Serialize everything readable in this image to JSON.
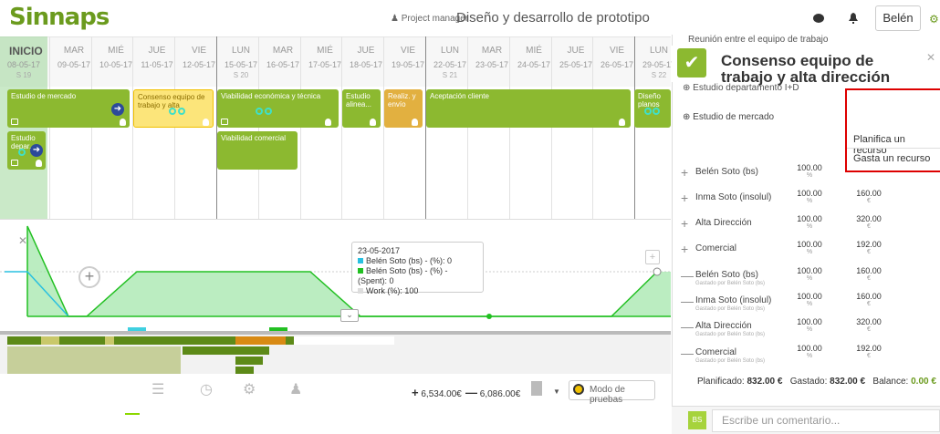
{
  "app": {
    "logo": "Sinnaps",
    "role_label": "Project manager",
    "project_title": "Diseño y desarrollo de prototipo",
    "user": "Belén"
  },
  "calendar": {
    "start_label": "INICIO",
    "days": [
      {
        "name": "MAR",
        "date": "08-05-17",
        "week": "S 19"
      },
      {
        "name": "MAR",
        "date": "09-05-17",
        "week": ""
      },
      {
        "name": "MIÉ",
        "date": "10-05-17",
        "week": ""
      },
      {
        "name": "JUE",
        "date": "11-05-17",
        "week": ""
      },
      {
        "name": "VIE",
        "date": "12-05-17",
        "week": ""
      },
      {
        "name": "LUN",
        "date": "15-05-17",
        "week": "S 20"
      },
      {
        "name": "MAR",
        "date": "16-05-17",
        "week": ""
      },
      {
        "name": "MIÉ",
        "date": "17-05-17",
        "week": ""
      },
      {
        "name": "JUE",
        "date": "18-05-17",
        "week": ""
      },
      {
        "name": "VIE",
        "date": "19-05-17",
        "week": ""
      },
      {
        "name": "LUN",
        "date": "22-05-17",
        "week": "S 21"
      },
      {
        "name": "MAR",
        "date": "23-05-17",
        "week": ""
      },
      {
        "name": "MIÉ",
        "date": "24-05-17",
        "week": ""
      },
      {
        "name": "JUE",
        "date": "25-05-17",
        "week": ""
      },
      {
        "name": "VIE",
        "date": "26-05-17",
        "week": ""
      },
      {
        "name": "LUN",
        "date": "29-05-17",
        "week": "S 22"
      }
    ]
  },
  "tasks": [
    {
      "label": "Estudio de mercado"
    },
    {
      "label": "Consenso equipo de trabajo y alta"
    },
    {
      "label": "Viabilidad económica y técnica"
    },
    {
      "label": "Estudio alinea..."
    },
    {
      "label": "Realiz. y envío"
    },
    {
      "label": "Aceptación cliente"
    },
    {
      "label": "Diseño planos"
    },
    {
      "label": "Estudio depar..."
    },
    {
      "label": "Viabilidad comercial"
    }
  ],
  "tooltip": {
    "date": "23-05-2017",
    "line1": "Belén Soto (bs) - (%): 0",
    "line2": "Belén Soto (bs) - (%) - (Spent): 0",
    "line3": "Work (%): 100"
  },
  "toolbar": {
    "plus_amount": "6,534.00€",
    "minus_amount": "6,086.00€",
    "test_mode": "Modo de pruebas"
  },
  "panel": {
    "top_line": "Reunión entre el equipo de trabajo",
    "title": "Consenso equipo de trabajo y alta dirección",
    "dep_line": "Estudio departamento I+D",
    "sub_item": "Estudio de mercado",
    "menu": {
      "plan": "Planifica un recurso",
      "spend": "Gasta un recurso"
    },
    "resources": [
      {
        "sym": "+",
        "name": "Belén Soto (bs)",
        "sub": "",
        "pct": "100.00",
        "pct_u": "%",
        "amt": "",
        "amt_u": ""
      },
      {
        "sym": "+",
        "name": "Inma Soto (insolul)",
        "sub": "",
        "pct": "100.00",
        "pct_u": "%",
        "amt": "160.00",
        "amt_u": "€"
      },
      {
        "sym": "+",
        "name": "Alta Dirección",
        "sub": "",
        "pct": "100.00",
        "pct_u": "%",
        "amt": "320.00",
        "amt_u": "€"
      },
      {
        "sym": "+",
        "name": "Comercial",
        "sub": "",
        "pct": "100.00",
        "pct_u": "%",
        "amt": "192.00",
        "amt_u": "€"
      },
      {
        "sym": "—",
        "name": "Belén Soto (bs)",
        "sub": "Gastado por Belén Soto (bs)",
        "pct": "100.00",
        "pct_u": "%",
        "amt": "160.00",
        "amt_u": "€"
      },
      {
        "sym": "—",
        "name": "Inma Soto (insolul)",
        "sub": "Gastado por Belén Soto (bs)",
        "pct": "100.00",
        "pct_u": "%",
        "amt": "160.00",
        "amt_u": "€"
      },
      {
        "sym": "—",
        "name": "Alta Dirección",
        "sub": "Gastado por Belén Soto (bs)",
        "pct": "100.00",
        "pct_u": "%",
        "amt": "320.00",
        "amt_u": "€"
      },
      {
        "sym": "—",
        "name": "Comercial",
        "sub": "Gastado por Belén Soto (bs)",
        "pct": "100.00",
        "pct_u": "%",
        "amt": "192.00",
        "amt_u": "€"
      }
    ],
    "summary": {
      "planned_label": "Planificado:",
      "planned": "832.00 €",
      "spent_label": "Gastado:",
      "spent": "832.00 €",
      "balance_label": "Balance:",
      "balance": "0.00 €"
    },
    "avatar": "BS",
    "comment_placeholder": "Escribe un comentario..."
  }
}
